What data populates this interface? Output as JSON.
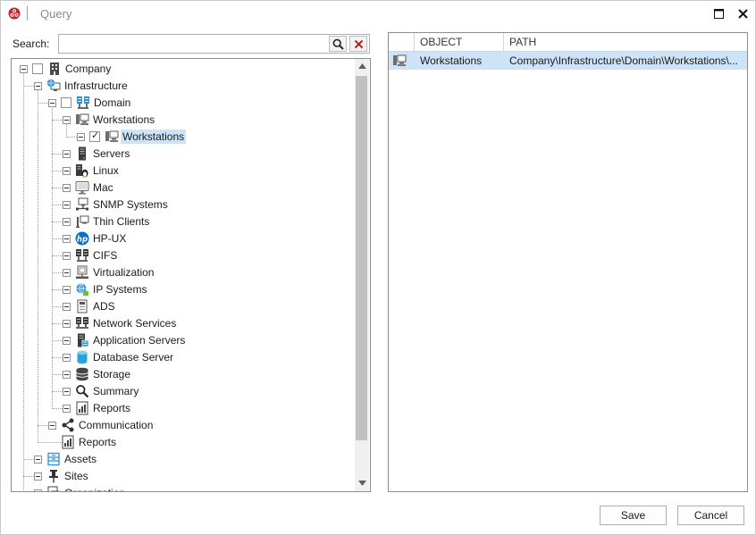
{
  "window": {
    "title": "Query",
    "maximize_label": "maximize",
    "close_label": "close"
  },
  "search": {
    "label": "Search:",
    "value": "",
    "placeholder": ""
  },
  "tree": {
    "nodes": [
      {
        "id": "company",
        "label": "Company",
        "level": 0,
        "icon": "building-icon",
        "checkbox": true,
        "checked": false
      },
      {
        "id": "infrastructure",
        "label": "Infrastructure",
        "level": 1,
        "icon": "globe-computer-icon"
      },
      {
        "id": "domain",
        "label": "Domain",
        "level": 2,
        "icon": "domain-icon",
        "checkbox": true,
        "checked": false
      },
      {
        "id": "workstations-group",
        "label": "Workstations",
        "level": 3,
        "icon": "workstation-icon"
      },
      {
        "id": "workstations-item",
        "label": "Workstations",
        "level": 4,
        "icon": "workstation-icon",
        "checkbox": true,
        "checked": true,
        "selected": true
      },
      {
        "id": "servers",
        "label": "Servers",
        "level": 3,
        "icon": "server-icon"
      },
      {
        "id": "linux",
        "label": "Linux",
        "level": 3,
        "icon": "linux-icon"
      },
      {
        "id": "mac",
        "label": "Mac",
        "level": 3,
        "icon": "monitor-icon"
      },
      {
        "id": "snmp",
        "label": "SNMP Systems",
        "level": 3,
        "icon": "snmp-icon"
      },
      {
        "id": "thin-clients",
        "label": "Thin Clients",
        "level": 3,
        "icon": "thin-client-icon"
      },
      {
        "id": "hp-ux",
        "label": "HP-UX",
        "level": 3,
        "icon": "hp-logo-icon"
      },
      {
        "id": "cifs",
        "label": "CIFS",
        "level": 3,
        "icon": "cifs-icon"
      },
      {
        "id": "virtualization",
        "label": "Virtualization",
        "level": 3,
        "icon": "virtualization-icon"
      },
      {
        "id": "ip-systems",
        "label": "IP Systems",
        "level": 3,
        "icon": "ip-globe-icon"
      },
      {
        "id": "ads",
        "label": "ADS",
        "level": 3,
        "icon": "ads-icon"
      },
      {
        "id": "network-services",
        "label": "Network Services",
        "level": 3,
        "icon": "network-services-icon"
      },
      {
        "id": "application-servers",
        "label": "Application Servers",
        "level": 3,
        "icon": "application-server-icon"
      },
      {
        "id": "database-server",
        "label": "Database Server",
        "level": 3,
        "icon": "database-icon"
      },
      {
        "id": "storage",
        "label": "Storage",
        "level": 3,
        "icon": "storage-icon"
      },
      {
        "id": "summary",
        "label": "Summary",
        "level": 3,
        "icon": "magnifier-icon"
      },
      {
        "id": "reports-infra",
        "label": "Reports",
        "level": 3,
        "icon": "report-icon"
      },
      {
        "id": "communication",
        "label": "Communication",
        "level": 2,
        "icon": "share-icon"
      },
      {
        "id": "reports-company",
        "label": "Reports",
        "level": 2,
        "icon": "report-icon",
        "leaf": true
      },
      {
        "id": "assets",
        "label": "Assets",
        "level": 1,
        "icon": "assets-icon"
      },
      {
        "id": "sites",
        "label": "Sites",
        "level": 1,
        "icon": "pin-icon"
      },
      {
        "id": "organization",
        "label": "Organization",
        "level": 1,
        "icon": "organization-icon"
      }
    ]
  },
  "grid": {
    "headers": [
      "",
      "OBJECT",
      "PATH"
    ],
    "rows": [
      {
        "icon": "workstation-icon",
        "object": "Workstations",
        "path": "Company\\Infrastructure\\Domain\\Workstations\\..."
      }
    ]
  },
  "buttons": {
    "save": "Save",
    "cancel": "Cancel"
  },
  "colors": {
    "selection": "#cde3f7",
    "app_icon": "#c0262d",
    "hp_blue": "#0a6fc2"
  }
}
